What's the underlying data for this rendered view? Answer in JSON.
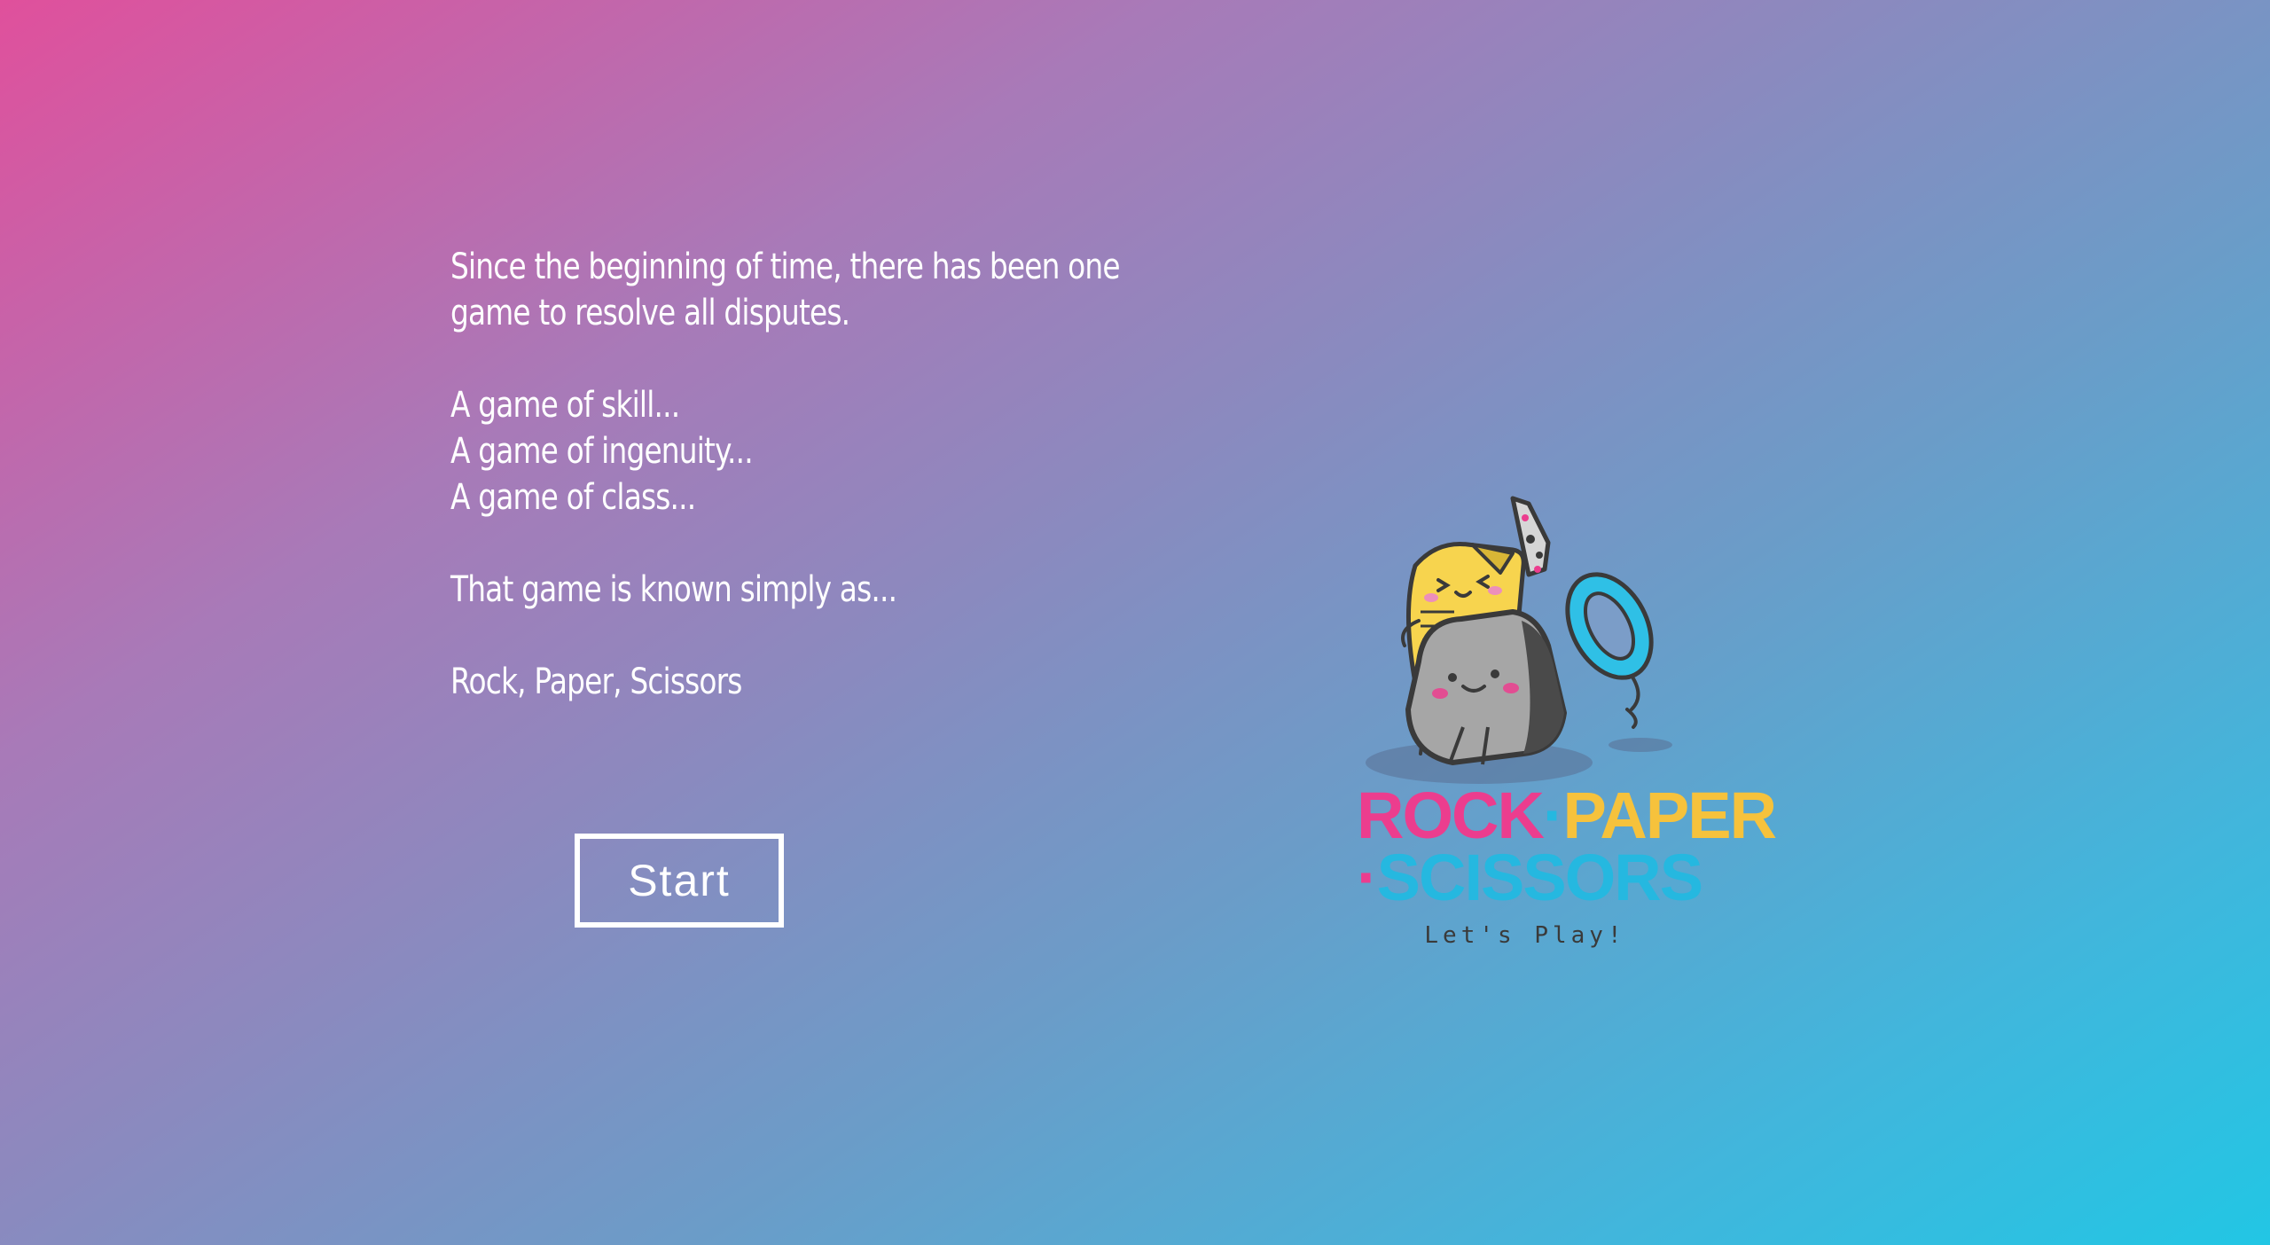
{
  "intro": {
    "paragraphs": [
      [
        "Since the beginning of time, there has been one",
        "game to resolve all disputes."
      ],
      [
        "A game of skill...",
        "A game of ingenuity...",
        "A game of class..."
      ],
      [
        "That game is known simply as..."
      ],
      [
        "Rock, Paper, Scissors"
      ]
    ]
  },
  "start_button": {
    "label": "Start"
  },
  "logo": {
    "word_rock": "ROCK",
    "separator": "·",
    "word_paper": "PAPER",
    "word_scissors": "SCISSORS",
    "tagline": "Let's Play!",
    "colors": {
      "rock": "#ec3d8e",
      "paper": "#f6c23c",
      "scissors": "#25b8e0"
    }
  },
  "background": {
    "gradient_start": "#e0509c",
    "gradient_end": "#22c6e4"
  }
}
